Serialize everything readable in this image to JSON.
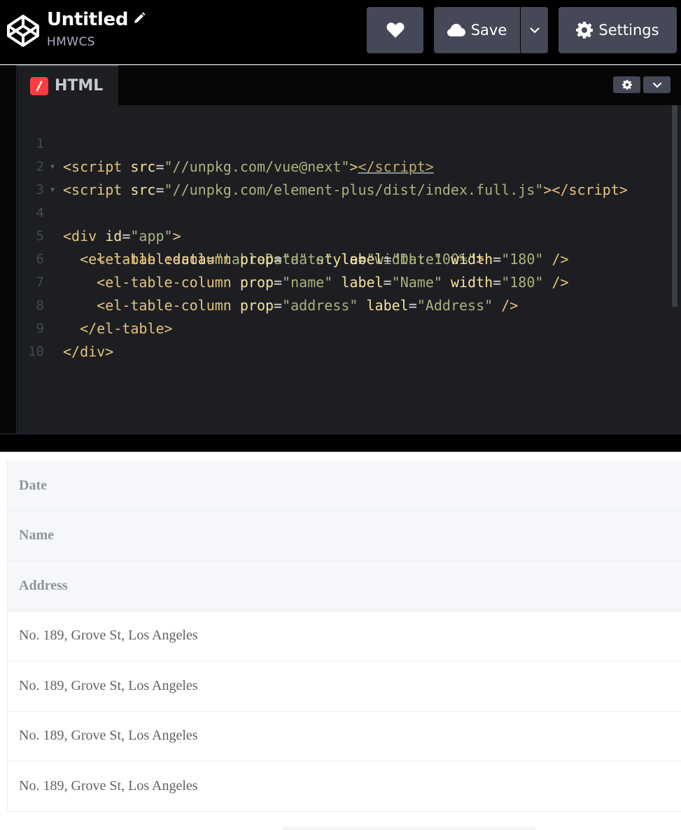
{
  "header": {
    "title": "Untitled",
    "owner": "HMWCS",
    "buttons": {
      "save_label": "Save",
      "settings_label": "Settings"
    },
    "icons": [
      "codepen-logo-icon",
      "pencil-icon",
      "heart-icon",
      "cloud-icon",
      "chevron-down-icon",
      "gear-icon"
    ]
  },
  "editor": {
    "tab_label": "HTML",
    "lines": [
      {
        "n": "1"
      },
      {
        "n": "2"
      },
      {
        "n": "3"
      },
      {
        "n": "4"
      },
      {
        "n": "5"
      },
      {
        "n": "6"
      },
      {
        "n": "7"
      },
      {
        "n": "8"
      },
      {
        "n": "9"
      },
      {
        "n": "10"
      }
    ],
    "code": {
      "l1_src": "\"//unpkg.com/vue@next\"",
      "l2_src": "\"//unpkg.com/element-plus/dist/index.full.js\"",
      "l3_id": "\"app\"",
      "l4_data": "\"tableData\"",
      "l4_style": "\"width: 100%\"",
      "l5_prop": "\"date\"",
      "l5_label": "\"Date\"",
      "l5_width": "\"180\"",
      "l6_prop": "\"name\"",
      "l6_label": "\"Name\"",
      "l6_width": "\"180\"",
      "l7_prop": "\"address\"",
      "l7_label": "\"Address\""
    }
  },
  "preview": {
    "header_rows": [
      "Date",
      "Name",
      "Address"
    ],
    "body_rows": [
      "No. 189, Grove St, Los Angeles",
      "No. 189, Grove St, Los Angeles",
      "No. 189, Grove St, Los Angeles",
      "No. 189, Grove St, Los Angeles"
    ]
  },
  "colors": {
    "header_bg": "#000000",
    "button_bg": "#444857",
    "editor_bg": "#1d1e22",
    "html_icon": "#ff3c41",
    "tag": "#e4c27c",
    "attr": "#f9e09f",
    "string": "#a9b37c"
  }
}
